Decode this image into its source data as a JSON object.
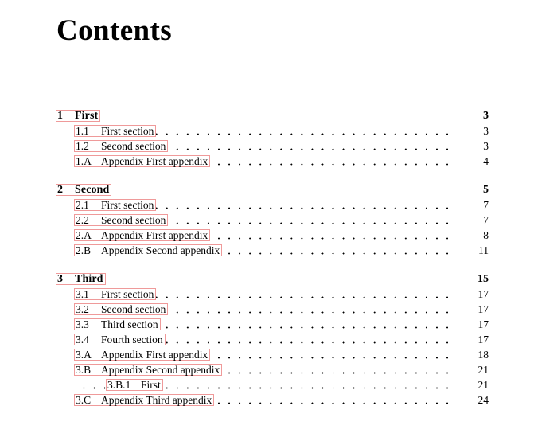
{
  "document": {
    "title": "Contents"
  },
  "toc": {
    "groups": [
      {
        "entries": [
          {
            "level": "chapter",
            "number": "1",
            "label": "First",
            "page": "3"
          },
          {
            "level": "section",
            "number": "1.1",
            "label": "First section",
            "page": "3"
          },
          {
            "level": "section",
            "number": "1.2",
            "label": "Second section",
            "page": "3"
          },
          {
            "level": "section",
            "number": "1.A",
            "label": "Appendix First appendix",
            "page": "4"
          }
        ]
      },
      {
        "entries": [
          {
            "level": "chapter",
            "number": "2",
            "label": "Second",
            "page": "5"
          },
          {
            "level": "section",
            "number": "2.1",
            "label": "First section",
            "page": "7"
          },
          {
            "level": "section",
            "number": "2.2",
            "label": "Second section",
            "page": "7"
          },
          {
            "level": "section",
            "number": "2.A",
            "label": "Appendix First appendix",
            "page": "8"
          },
          {
            "level": "section",
            "number": "2.B",
            "label": "Appendix Second appendix",
            "page": "11"
          }
        ]
      },
      {
        "entries": [
          {
            "level": "chapter",
            "number": "3",
            "label": "Third",
            "page": "15"
          },
          {
            "level": "section",
            "number": "3.1",
            "label": "First section",
            "page": "17"
          },
          {
            "level": "section",
            "number": "3.2",
            "label": "Second section",
            "page": "17"
          },
          {
            "level": "section",
            "number": "3.3",
            "label": "Third section",
            "page": "17"
          },
          {
            "level": "section",
            "number": "3.4",
            "label": "Fourth section",
            "page": "17"
          },
          {
            "level": "section",
            "number": "3.A",
            "label": "Appendix First appendix",
            "page": "18"
          },
          {
            "level": "section",
            "number": "3.B",
            "label": "Appendix Second appendix",
            "page": "21"
          },
          {
            "level": "subsection",
            "number": "3.B.1",
            "label": "First",
            "page": "21"
          },
          {
            "level": "section",
            "number": "3.C",
            "label": "Appendix Third appendix",
            "page": "24"
          }
        ]
      }
    ]
  },
  "style": {
    "link_box_color": "#ef9a9a",
    "text_color": "#000000",
    "page_background": "#ffffff"
  }
}
